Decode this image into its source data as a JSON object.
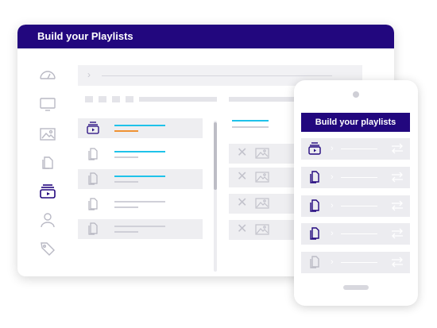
{
  "desktop": {
    "title": "Build your Playlists",
    "breadcrumb_separator": "›",
    "sidebar": {
      "items": [
        {
          "name": "dashboard",
          "icon": "gauge-icon",
          "active": false
        },
        {
          "name": "screens",
          "icon": "monitor-icon",
          "active": false
        },
        {
          "name": "images",
          "icon": "image-icon",
          "active": false
        },
        {
          "name": "documents",
          "icon": "files-icon",
          "active": false
        },
        {
          "name": "playlists",
          "icon": "playlist-icon",
          "active": true
        },
        {
          "name": "users",
          "icon": "user-icon",
          "active": false
        },
        {
          "name": "tags",
          "icon": "tag-icon",
          "active": false
        }
      ]
    },
    "playlist_rows": [
      {
        "icon": "playlist-icon",
        "highlighted": true,
        "active": true,
        "title_accent": "#1fc2ea",
        "subtitle_accent": "#ef9233"
      },
      {
        "icon": "files-icon",
        "highlighted": false,
        "active": false,
        "title_accent": "#1fc2ea",
        "subtitle_accent": "#cfcfd7"
      },
      {
        "icon": "files-icon",
        "highlighted": true,
        "active": false,
        "title_accent": "#1fc2ea",
        "subtitle_accent": "#cfcfd7"
      },
      {
        "icon": "files-icon",
        "highlighted": false,
        "active": false,
        "title_accent": "#cfcfd7",
        "subtitle_accent": "#cfcfd7"
      },
      {
        "icon": "files-icon",
        "highlighted": true,
        "active": false,
        "title_accent": "#cfcfd7",
        "subtitle_accent": "#cfcfd7"
      }
    ],
    "media_rows": [
      {
        "remove_icon": "close-icon",
        "thumb_icon": "image-icon"
      },
      {
        "remove_icon": "close-icon",
        "thumb_icon": "image-icon"
      },
      {
        "remove_icon": "close-icon",
        "thumb_icon": "image-icon"
      },
      {
        "remove_icon": "close-icon",
        "thumb_icon": "image-icon"
      }
    ]
  },
  "phone": {
    "title": "Build your playlists",
    "row_separator": "›",
    "rows": [
      {
        "icon": "playlist-icon",
        "active": true
      },
      {
        "icon": "files-icon",
        "active": true
      },
      {
        "icon": "files-icon",
        "active": true
      },
      {
        "icon": "files-icon",
        "active": true
      },
      {
        "icon": "files-icon",
        "active": false
      }
    ],
    "row_action_icon": "swap-icon"
  },
  "colors": {
    "brand": "#22077e",
    "accent_blue": "#1fc2ea",
    "accent_orange": "#ef9233",
    "row_bg": "#eeeef1"
  }
}
